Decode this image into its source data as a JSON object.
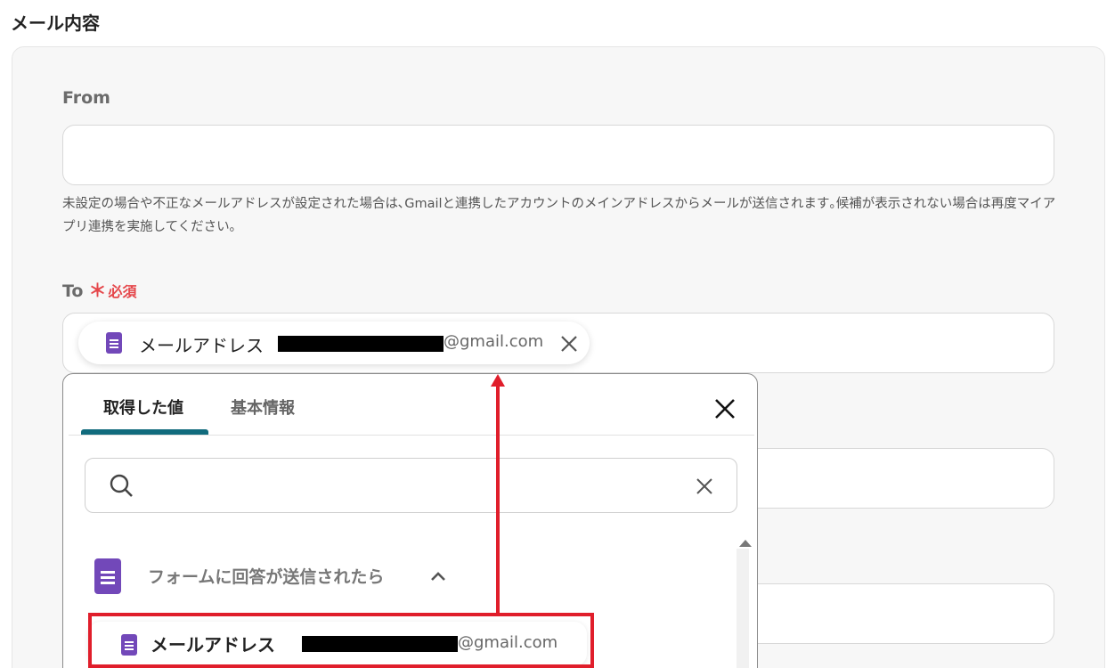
{
  "section_title": "メール内容",
  "from": {
    "label": "From",
    "value": "",
    "hint": "未設定の場合や不正なメールアドレスが設定された場合は､Gmailと連携したアカウントのメインアドレスからメールが送信されます｡候補が表示されない場合は再度マイアプリ連携を実施してください｡"
  },
  "to": {
    "label": "To",
    "required_mark": "＊",
    "required_text": "必須",
    "chip": {
      "icon": "google-forms-icon",
      "label": "メールアドレス",
      "email_suffix": "@gmail.com"
    }
  },
  "popup": {
    "tabs": [
      "取得した値",
      "基本情報"
    ],
    "active_tab": "取得した値",
    "search": {
      "value": "",
      "placeholder": ""
    },
    "group": {
      "label": "フォームに回答が送信されたら",
      "icon": "google-forms-icon",
      "expanded": true
    },
    "item": {
      "label": "メールアドレス",
      "email_suffix": "@gmail.com",
      "icon": "google-forms-icon"
    }
  },
  "colors": {
    "required": "#e5474b",
    "tab_accent": "#116b7d",
    "forms_purple": "#7248b9",
    "annotation_red": "#e01e2b"
  }
}
